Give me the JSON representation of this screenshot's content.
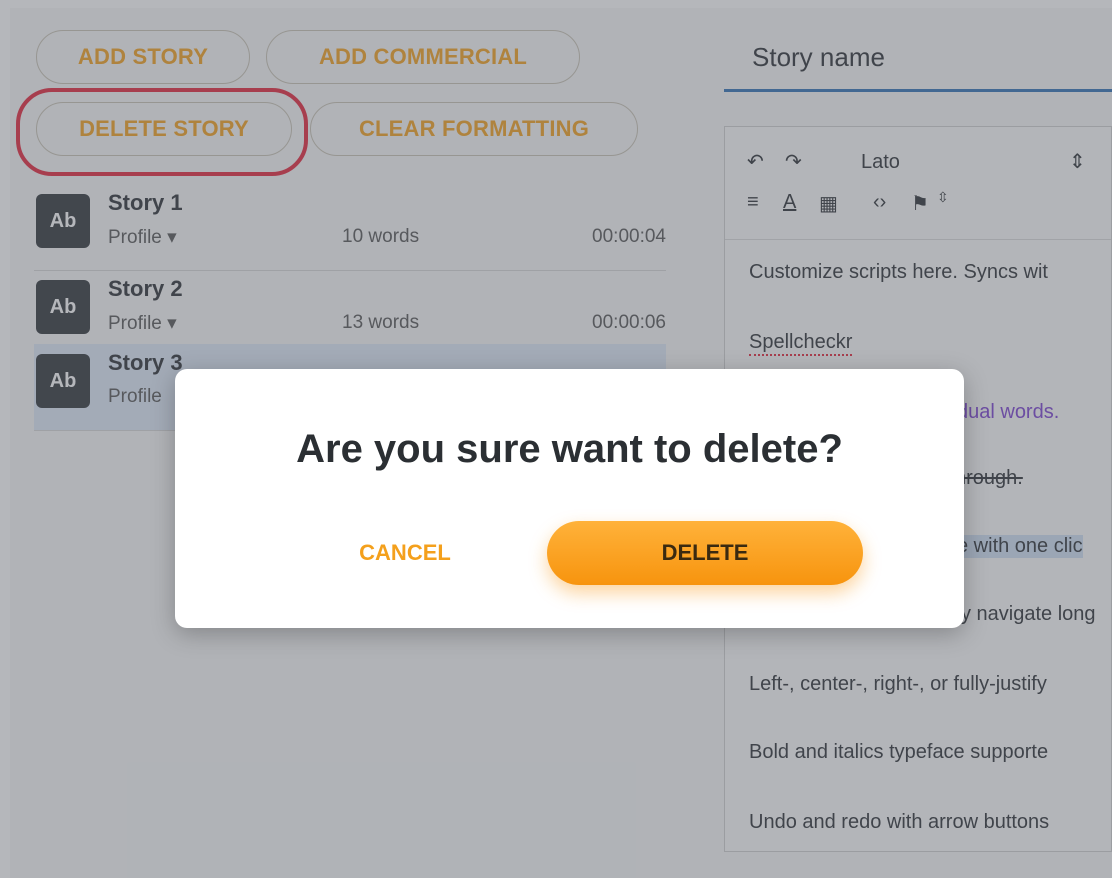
{
  "buttons": {
    "add_story": "ADD STORY",
    "add_commercial": "ADD COMMERCIAL",
    "delete_story": "DELETE STORY",
    "clear_formatting": "CLEAR FORMATTING"
  },
  "stories": [
    {
      "title": "Story 1",
      "avatar": "Ab",
      "profile": "Profile ▾",
      "words": "10 words",
      "time": "00:00:04"
    },
    {
      "title": "Story 2",
      "avatar": "Ab",
      "profile": "Profile ▾",
      "words": "13 words",
      "time": "00:00:06"
    },
    {
      "title": "Story 3",
      "avatar": "Ab",
      "profile": "Profile",
      "words": "",
      "time": ""
    }
  ],
  "story_name": {
    "placeholder": "Story name"
  },
  "toolbar": {
    "font": "Lato"
  },
  "editor_lines": [
    "Customize scripts here. Syncs wit",
    "Spellcheckr",
    "dual words.",
    "hrough.",
    "e with one clic",
    "y navigate long",
    "Left-, center-, right-, or fully-justify",
    "Bold and italics typeface supporte",
    "Undo and redo with arrow buttons"
  ],
  "modal": {
    "title": "Are you sure want to delete?",
    "cancel": "CANCEL",
    "delete": "DELETE"
  }
}
